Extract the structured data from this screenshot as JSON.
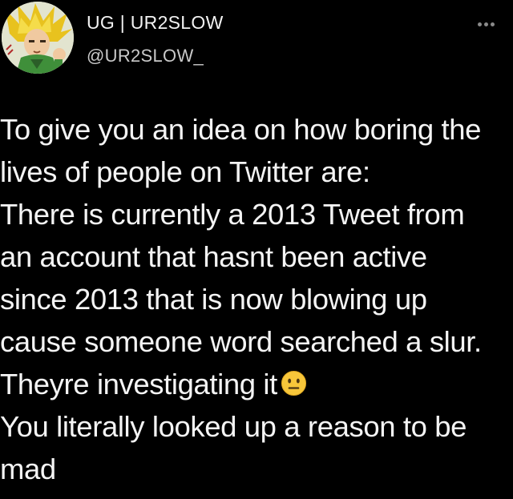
{
  "user": {
    "display_name": "UG | UR2SLOW",
    "handle": "@UR2SLOW_",
    "avatar_icon": "anime-character-avatar"
  },
  "more_icon": "more-horizontal-icon",
  "tweet": {
    "lines": [
      "To give you an idea on how boring the",
      "lives of people on Twitter are:",
      "There is currently a 2013 Tweet from",
      "an account that hasnt been active",
      "since 2013 that is now blowing up",
      "cause someone word searched a slur.",
      "Theyre investigating it",
      "You literally looked up a reason to be",
      "mad"
    ],
    "emoji": "neutral-face-emoji"
  },
  "colors": {
    "background": "#000000",
    "text": "#f4f4f4",
    "handle": "#c9c9c9",
    "emoji": "#f7c63a"
  }
}
